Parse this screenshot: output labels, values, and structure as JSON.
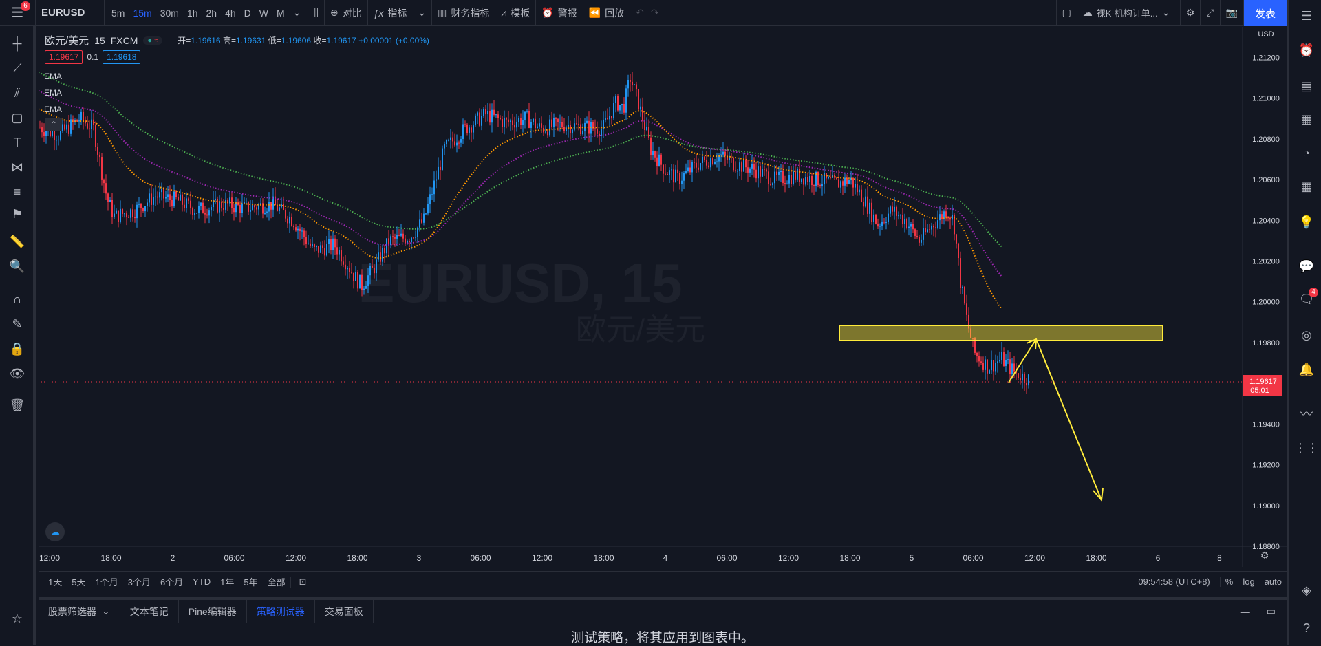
{
  "topbar": {
    "menu_badge": "6",
    "symbol": "EURUSD",
    "timeframes": [
      "5m",
      "15m",
      "30m",
      "1h",
      "2h",
      "4h",
      "D",
      "W",
      "M"
    ],
    "active_timeframe": "15m",
    "compare": "对比",
    "indicators": "指标",
    "financials": "财务指标",
    "templates": "模板",
    "alerts": "警报",
    "replay": "回放",
    "layout_name": "裸K-机构订单...",
    "publish": "发表"
  },
  "legend": {
    "pair": "欧元/美元",
    "interval": "15",
    "exchange": "FXCM",
    "open_label": "开=",
    "open": "1.19616",
    "high_label": "高=",
    "high": "1.19631",
    "low_label": "低=",
    "low": "1.19606",
    "close_label": "收=",
    "close": "1.19617",
    "change": "+0.00001 (+0.00%)",
    "sell_price": "1.19617",
    "spread": "0.1",
    "buy_price": "1.19618"
  },
  "ema_labels": [
    "EMA",
    "EMA",
    "EMA"
  ],
  "watermark": {
    "symbol": "EURUSD, 15",
    "name": "欧元/美元"
  },
  "price_axis": {
    "currency": "USD",
    "current_price": "1.19617",
    "countdown": "05:01"
  },
  "chart_data": {
    "type": "candlestick",
    "y_ticks": [
      "1.21200",
      "1.21000",
      "1.20800",
      "1.20600",
      "1.20400",
      "1.20200",
      "1.20000",
      "1.19800",
      "1.19400",
      "1.19200",
      "1.19000",
      "1.18800"
    ],
    "x_ticks": [
      "12:00",
      "18:00",
      "2",
      "06:00",
      "12:00",
      "18:00",
      "3",
      "06:00",
      "12:00",
      "18:00",
      "4",
      "06:00",
      "12:00",
      "18:00",
      "5",
      "06:00",
      "12:00",
      "18:00",
      "6",
      "8"
    ],
    "ylim": [
      1.188,
      1.2135
    ],
    "current_price": 1.19617,
    "series": [
      {
        "name": "EMA",
        "color": "#4caf50"
      },
      {
        "name": "EMA",
        "color": "#9c27b0"
      },
      {
        "name": "EMA",
        "color": "#ff9800"
      }
    ],
    "annotations": [
      "yellow supply zone 1.1984-1.1991",
      "projection arrow up to zone then down to ~1.1900"
    ]
  },
  "bottom_bar": {
    "ranges": [
      "1天",
      "5天",
      "1个月",
      "3个月",
      "6个月",
      "YTD",
      "1年",
      "5年",
      "全部"
    ],
    "clock": "09:54:58 (UTC+8)",
    "percent": "%",
    "log": "log",
    "auto": "auto"
  },
  "panel": {
    "tabs": [
      "股票筛选器",
      "文本笔记",
      "Pine编辑器",
      "策略测试器",
      "交易面板"
    ],
    "active_tab": "策略测试器",
    "message": "测试策略，将其应用到图表中。"
  },
  "right_badge": "4",
  "colors": {
    "up": "#2196f3",
    "down": "#f23645",
    "accent": "#2962ff",
    "zone": "#ffeb3b"
  }
}
